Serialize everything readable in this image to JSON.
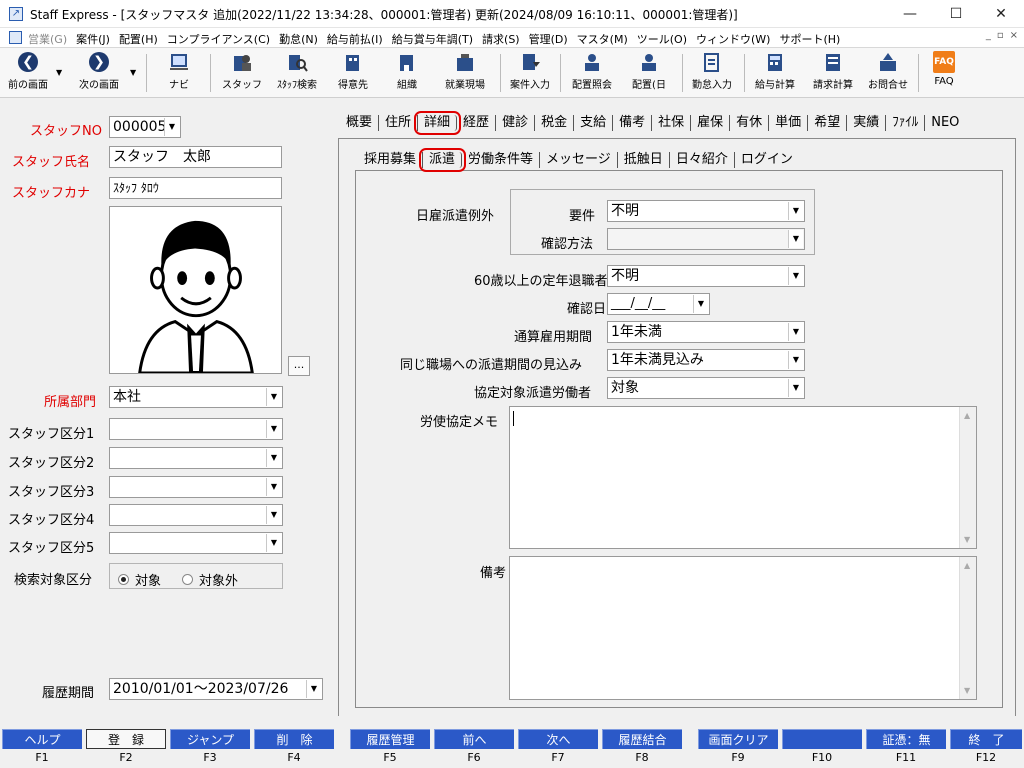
{
  "window": {
    "title": "Staff Express - [スタッフマスタ 追加(2022/11/22 13:34:28、000001:管理者) 更新(2024/08/09 16:10:11、000001:管理者)]",
    "controls": [
      "—",
      "☐",
      "✕"
    ]
  },
  "menu": {
    "items": [
      "営業(G)",
      "案件(J)",
      "配置(H)",
      "コンプライアンス(C)",
      "勤怠(N)",
      "給与前払(I)",
      "給与賞与年調(T)",
      "請求(S)",
      "管理(D)",
      "マスタ(M)",
      "ツール(O)",
      "ウィンドウ(W)",
      "サポート(H)"
    ],
    "mdi_controls": [
      "_",
      "▫",
      "×"
    ]
  },
  "toolbar": {
    "back": "前の画面",
    "forward": "次の画面",
    "navi": "ナビ",
    "staff": "スタッフ",
    "staff_search": "ｽﾀｯﾌ検索",
    "client": "得意先",
    "org": "組織",
    "site": "就業現場",
    "job_entry": "案件入力",
    "assign_ref": "配置照会",
    "assign": "配置(日",
    "attendance": "勤怠入力",
    "payroll": "給与計算",
    "billing": "請求計算",
    "contact": "お問合せ",
    "faq": "FAQ",
    "faq_icon": "FAQ"
  },
  "left": {
    "staff_no_label": "スタッフNO",
    "staff_no": "000005",
    "staff_name_label": "スタッフ氏名",
    "staff_name": "スタッフ　太郎",
    "staff_kana_label": "スタッフカナ",
    "staff_kana": "ｽﾀｯﾌ ﾀﾛｳ",
    "photo_button": "...",
    "dept_label": "所属部門",
    "dept": "本社",
    "kubun1_label": "スタッフ区分1",
    "kubun2_label": "スタッフ区分2",
    "kubun3_label": "スタッフ区分3",
    "kubun4_label": "スタッフ区分4",
    "kubun5_label": "スタッフ区分5",
    "search_label": "検索対象区分",
    "radio_on": "対象",
    "radio_off": "対象外",
    "history_label": "履歴期間",
    "history": "2010/01/01～2023/07/26"
  },
  "tabs_main": [
    "概要",
    "住所",
    "詳細",
    "経歴",
    "健診",
    "税金",
    "支給",
    "備考",
    "社保",
    "雇保",
    "有休",
    "単価",
    "希望",
    "実績",
    "ﾌｧｲﾙ",
    "NEO"
  ],
  "tabs_main_active": "詳細",
  "tabs_sub": [
    "採用募集",
    "派遣",
    "労働条件等",
    "メッセージ",
    "抵触日",
    "日々紹介",
    "ログイン"
  ],
  "tabs_sub_active": "派遣",
  "form": {
    "day_exception_label": "日雇派遣例外",
    "requirement_label": "要件",
    "requirement": "不明",
    "confirm_method_label": "確認方法",
    "confirm_method": "",
    "retiree60_label": "60歳以上の定年退職者",
    "retiree60": "不明",
    "confirm_date_label": "確認日",
    "confirm_date": "___/__/__",
    "total_period_label": "通算雇用期間",
    "total_period": "1年未満",
    "same_workplace_label": "同じ職場への派遣期間の見込み",
    "same_workplace": "1年未満見込み",
    "agreement_worker_label": "協定対象派遣労働者",
    "agreement_worker": "対象",
    "memo_label": "労使協定メモ",
    "remarks_label": "備考"
  },
  "fkeys": [
    {
      "label": "ヘルプ",
      "key": "F1"
    },
    {
      "label": "登　録",
      "key": "F2"
    },
    {
      "label": "ジャンプ",
      "key": "F3"
    },
    {
      "label": "削　除",
      "key": "F4"
    },
    {
      "label": "履歴管理",
      "key": "F5"
    },
    {
      "label": "前へ",
      "key": "F6"
    },
    {
      "label": "次へ",
      "key": "F7"
    },
    {
      "label": "履歴結合",
      "key": "F8"
    },
    {
      "label": "画面クリア",
      "key": "F9"
    },
    {
      "label": "",
      "key": "F10"
    },
    {
      "label": "証憑：無",
      "key": "F11"
    },
    {
      "label": "終　了",
      "key": "F12"
    }
  ]
}
